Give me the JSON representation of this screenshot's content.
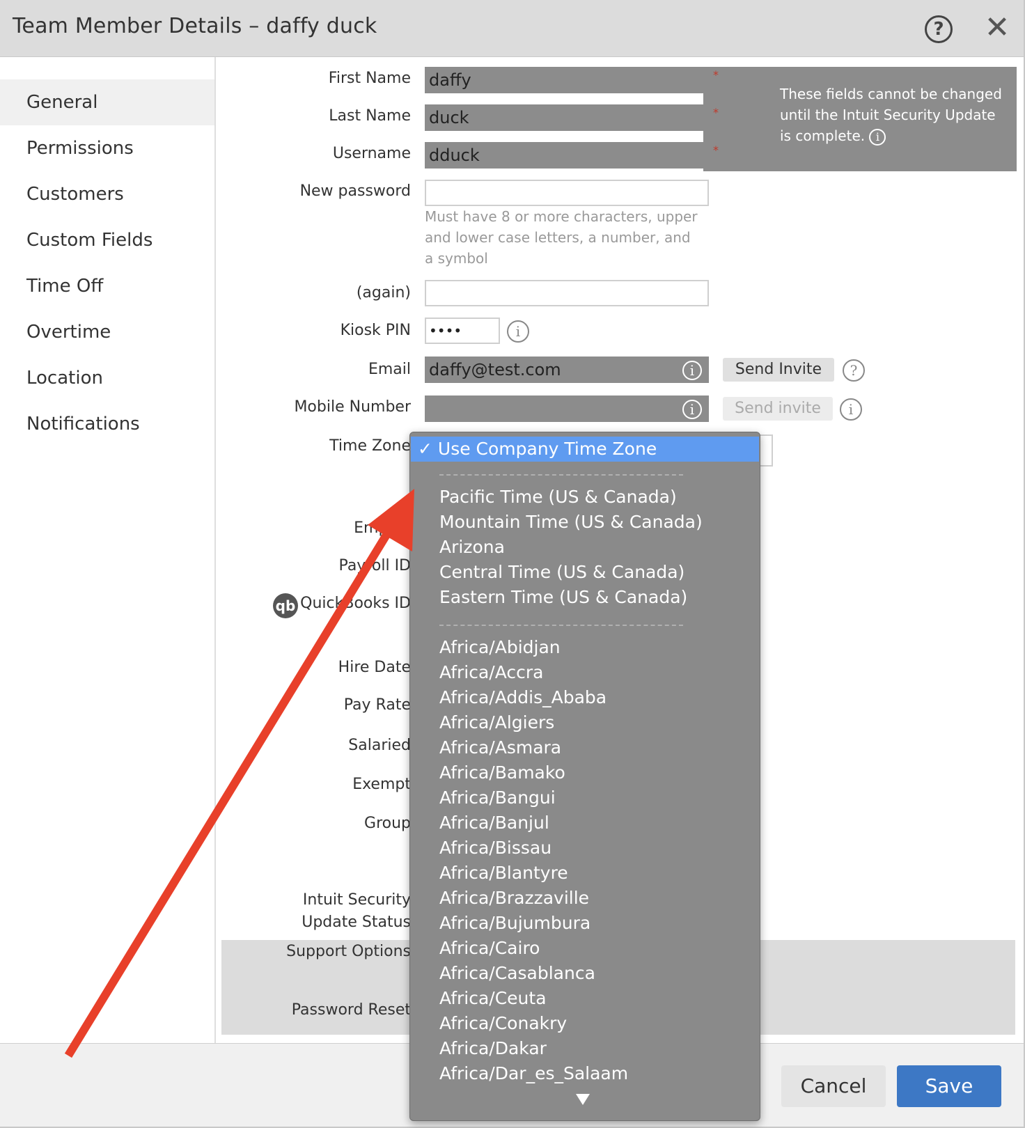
{
  "window": {
    "title": "Team Member Details – daffy duck"
  },
  "sidebar": {
    "items": [
      {
        "label": "General",
        "active": true
      },
      {
        "label": "Permissions"
      },
      {
        "label": "Customers"
      },
      {
        "label": "Custom Fields"
      },
      {
        "label": "Time Off"
      },
      {
        "label": "Overtime"
      },
      {
        "label": "Location"
      },
      {
        "label": "Notifications"
      }
    ]
  },
  "form": {
    "first_name": {
      "label": "First Name",
      "value": "daffy"
    },
    "last_name": {
      "label": "Last Name",
      "value": "duck"
    },
    "username": {
      "label": "Username",
      "value": "dduck"
    },
    "required_mark": "*",
    "locked_note": "These fields cannot be changed until the Intuit Security Update is complete.",
    "new_password": {
      "label": "New password",
      "value": ""
    },
    "password_hint": "Must have 8 or more characters, upper and lower case letters, a number, and a symbol",
    "password_again": {
      "label": "(again)",
      "value": ""
    },
    "kiosk_pin": {
      "label": "Kiosk PIN",
      "value": "••••"
    },
    "email": {
      "label": "Email",
      "value": "daffy@test.com",
      "send_label": "Send Invite"
    },
    "mobile": {
      "label": "Mobile Number",
      "value": "",
      "send_label": "Send invite"
    },
    "time_zone": {
      "label": "Time Zone"
    },
    "employee_number": {
      "label": "Employ"
    },
    "payroll_id": {
      "label": "Payroll ID"
    },
    "quickbooks_id": {
      "label": "QuickBooks ID",
      "icon_text": "qb"
    },
    "hire_date": {
      "label": "Hire Date"
    },
    "pay_rate": {
      "label": "Pay Rate"
    },
    "salaried": {
      "label": "Salaried"
    },
    "exempt": {
      "label": "Exempt"
    },
    "group": {
      "label": "Group"
    },
    "intuit_status": {
      "label_line1": "Intuit Security",
      "label_line2": "Update Status"
    },
    "support_options": {
      "label": "Support Options"
    },
    "password_reset": {
      "label": "Password Reset"
    }
  },
  "timezone_dropdown": {
    "selected": "✓ Use Company Time Zone",
    "group_us": [
      "Pacific Time (US & Canada)",
      "Mountain Time (US & Canada)",
      "Arizona",
      "Central Time (US & Canada)",
      "Eastern Time (US & Canada)"
    ],
    "group_world": [
      "Africa/Abidjan",
      "Africa/Accra",
      "Africa/Addis_Ababa",
      "Africa/Algiers",
      "Africa/Asmara",
      "Africa/Bamako",
      "Africa/Bangui",
      "Africa/Banjul",
      "Africa/Bissau",
      "Africa/Blantyre",
      "Africa/Brazzaville",
      "Africa/Bujumbura",
      "Africa/Cairo",
      "Africa/Casablanca",
      "Africa/Ceuta",
      "Africa/Conakry",
      "Africa/Dakar",
      "Africa/Dar_es_Salaam"
    ]
  },
  "footer": {
    "cancel_label": "Cancel",
    "save_label": "Save"
  },
  "colors": {
    "accent": "#3d78c5",
    "dropdown_highlight": "#5f9bf0",
    "locked_field": "#8c8c8c",
    "annotation_arrow": "#e8402a"
  },
  "icons": {
    "help": "question-circle-icon",
    "close": "close-icon",
    "info": "info-circle-icon",
    "quickbooks": "quickbooks-icon",
    "scroll_down": "triangle-down-icon"
  }
}
